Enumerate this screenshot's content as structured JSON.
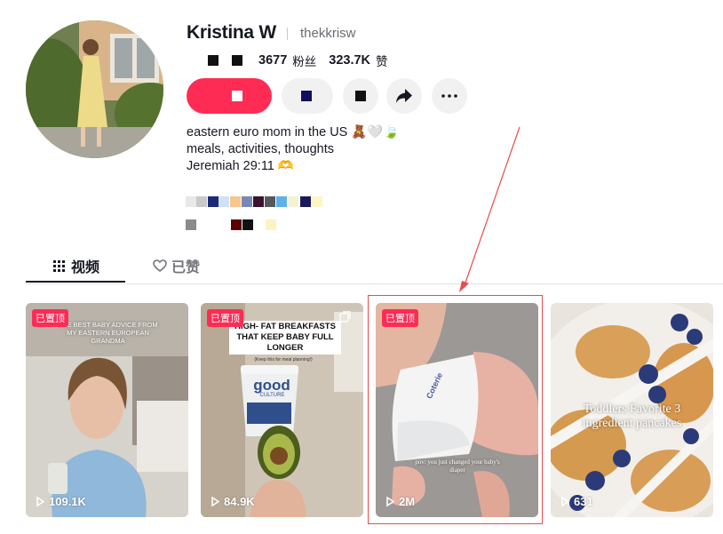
{
  "profile": {
    "name": "Kristina W",
    "handle": "thekkrisw",
    "followers_count": "3677",
    "followers_label": "粉丝",
    "likes_count": "323.7K",
    "likes_label": "赞",
    "bio_line1": "eastern euro mom in the US 🧸🤍🍃",
    "bio_line2": "meals, activities, thoughts",
    "bio_line3": "Jeremiah 29:11 🫶"
  },
  "tabs": [
    {
      "label": "视频"
    },
    {
      "label": "已赞"
    }
  ],
  "videos": [
    {
      "pinned_label": "已置顶",
      "views": "109.1K",
      "caption": "THE BEST BABY ADVICE FROM MY EASTERN EUROPEAN GRANDMA"
    },
    {
      "pinned_label": "已置顶",
      "views": "84.9K",
      "caption": "HIGH- FAT BREAKFASTS THAT KEEP BABY FULL LONGER",
      "sub": "(Keep this for meal planning!)",
      "brand": "good",
      "brand2": "CULTURE"
    },
    {
      "pinned_label": "已置顶",
      "views": "2M",
      "caption": "pov: you just changed your baby's diaper",
      "brand": "Coterie"
    },
    {
      "views": "631",
      "caption": "Toddlers Favorite 3 ingredient pancakes"
    }
  ],
  "colors": {
    "accent": "#fe2c55",
    "highlight": "#e64d4d"
  }
}
